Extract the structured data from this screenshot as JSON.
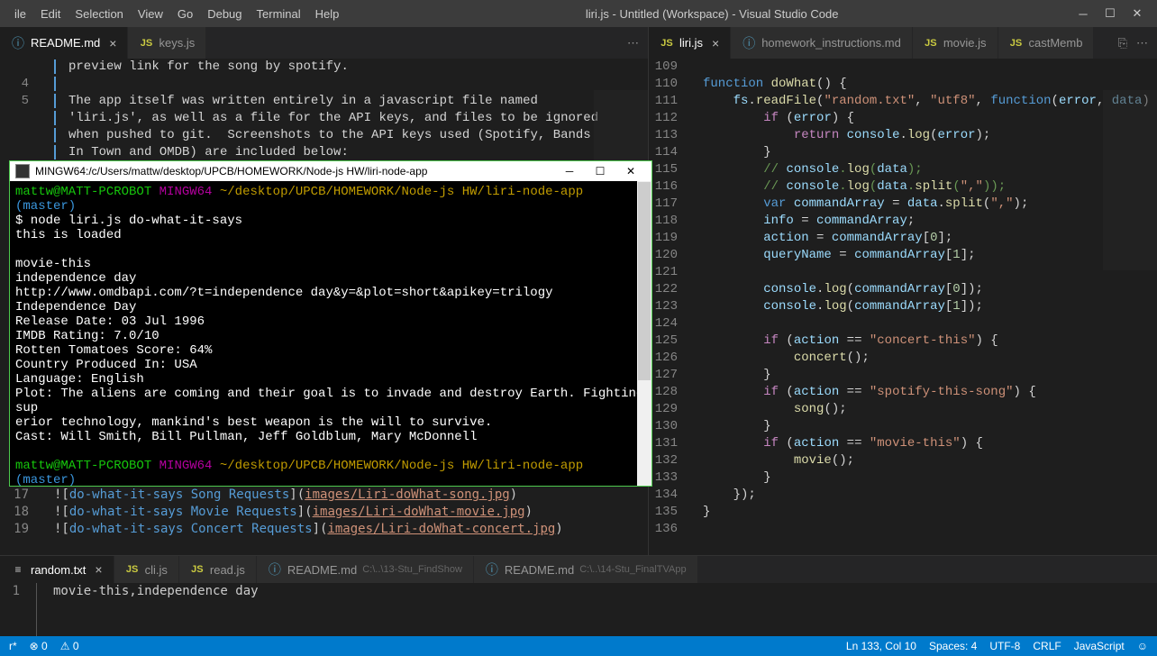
{
  "menubar": {
    "items": [
      "File",
      "Edit",
      "Selection",
      "View",
      "Go",
      "Debug",
      "Terminal",
      "Help"
    ],
    "title": "liri.js - Untitled (Workspace) - Visual Studio Code"
  },
  "leftTabs": [
    {
      "label": "README.md",
      "icon": "info",
      "active": true,
      "close": true
    },
    {
      "label": "keys.js",
      "icon": "js",
      "active": false,
      "close": false
    }
  ],
  "rightTabs": [
    {
      "label": "liri.js",
      "icon": "js",
      "active": true,
      "close": true
    },
    {
      "label": "homework_instructions.md",
      "icon": "info",
      "active": false,
      "close": false
    },
    {
      "label": "movie.js",
      "icon": "js",
      "active": false,
      "close": false
    },
    {
      "label": "castMemb",
      "icon": "js",
      "active": false,
      "close": false
    }
  ],
  "leftEditor": {
    "lines": [
      {
        "n": "",
        "t": "preview link for the song by spotify."
      },
      {
        "n": "4",
        "t": ""
      },
      {
        "n": "5",
        "t": "The app itself was written entirely in a javascript file named"
      },
      {
        "n": "",
        "t": "'liri.js', as well as a file for the API keys, and files to be ignored"
      },
      {
        "n": "",
        "t": "when pushed to git.  Screenshots to the API keys used (Spotify, Bands"
      },
      {
        "n": "",
        "t": "In Town and OMDB) are included below:"
      }
    ],
    "bottomLines": [
      {
        "n": "17",
        "link": "do-what-it-says Song Requests",
        "path": "images/Liri-doWhat-song.jpg"
      },
      {
        "n": "18",
        "link": "do-what-it-says Movie Requests",
        "path": "images/Liri-doWhat-movie.jpg"
      },
      {
        "n": "19",
        "link": "do-what-it-says Concert Requests",
        "path": "images/Liri-doWhat-concert.jpg"
      }
    ]
  },
  "rightEditor": {
    "startLine": 109,
    "lines": [
      "",
      "function doWhat() {",
      "    fs.readFile(\"random.txt\", \"utf8\", function(error, data)",
      "        if (error) {",
      "            return console.log(error);",
      "        }",
      "        // console.log(data);",
      "        // console.log(data.split(\",\"));",
      "        var commandArray = data.split(\",\");",
      "        info = commandArray;",
      "        action = commandArray[0];",
      "        queryName = commandArray[1];",
      "",
      "        console.log(commandArray[0]);",
      "        console.log(commandArray[1]);",
      "",
      "        if (action == \"concert-this\") {",
      "            concert();",
      "        }",
      "        if (action == \"spotify-this-song\") {",
      "            song();",
      "        }",
      "        if (action == \"movie-this\") {",
      "            movie();",
      "        }",
      "    });",
      "}",
      ""
    ]
  },
  "terminal": {
    "title": "MINGW64:/c/Users/mattw/desktop/UPCB/HOMEWORK/Node-js HW/liri-node-app",
    "prompt": {
      "user": "mattw@MATT-PCROBOT",
      "env": "MINGW64",
      "path": "~/desktop/UPCB/HOMEWORK/Node-js HW/liri-node-app",
      "branch": "(master)"
    },
    "cmd": "$ node liri.js do-what-it-says",
    "output": [
      "this is loaded",
      "",
      "movie-this",
      "independence day",
      "http://www.omdbapi.com/?t=independence day&y=&plot=short&apikey=trilogy",
      "Independence Day",
      "Release Date: 03 Jul 1996",
      "IMDB Rating: 7.0/10",
      "Rotten Tomatoes Score: 64%",
      "Country Produced In: USA",
      "Language: English",
      "Plot: The aliens are coming and their goal is to invade and destroy Earth. Fighting sup",
      "erior technology, mankind's best weapon is the will to survive.",
      "Cast: Will Smith, Bill Pullman, Jeff Goldblum, Mary McDonnell"
    ]
  },
  "bottomTabs": [
    {
      "label": "random.txt",
      "icon": "txt",
      "active": true,
      "close": true,
      "sub": ""
    },
    {
      "label": "cli.js",
      "icon": "js",
      "active": false
    },
    {
      "label": "read.js",
      "icon": "js",
      "active": false
    },
    {
      "label": "README.md",
      "icon": "info",
      "active": false,
      "sub": "C:\\..\\13-Stu_FindShow"
    },
    {
      "label": "README.md",
      "icon": "info",
      "active": false,
      "sub": "C:\\..\\14-Stu_FinalTVApp"
    }
  ],
  "bottomEditor": {
    "line": "1",
    "content": "movie-this,independence day"
  },
  "statusbar": {
    "left": [
      "r*",
      "⊗ 0",
      "⚠ 0"
    ],
    "right": [
      "Ln 133, Col 10",
      "Spaces: 4",
      "UTF-8",
      "CRLF",
      "JavaScript",
      "☺"
    ]
  }
}
